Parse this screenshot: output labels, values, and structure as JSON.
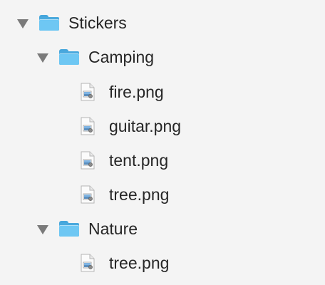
{
  "tree": {
    "root": {
      "label": "Stickers",
      "expanded": true,
      "icon": "folder-icon",
      "children": [
        {
          "label": "Camping",
          "expanded": true,
          "icon": "folder-icon",
          "children": [
            {
              "label": "fire.png",
              "icon": "png-file-icon"
            },
            {
              "label": "guitar.png",
              "icon": "png-file-icon"
            },
            {
              "label": "tent.png",
              "icon": "png-file-icon"
            },
            {
              "label": "tree.png",
              "icon": "png-file-icon"
            }
          ]
        },
        {
          "label": "Nature",
          "expanded": true,
          "icon": "folder-icon",
          "children": [
            {
              "label": "tree.png",
              "icon": "png-file-icon"
            }
          ]
        }
      ]
    }
  },
  "colors": {
    "background": "#f4f4f4",
    "folder": "#6ec7f3",
    "disclosure": "#7a7a7a",
    "text": "#262626"
  }
}
